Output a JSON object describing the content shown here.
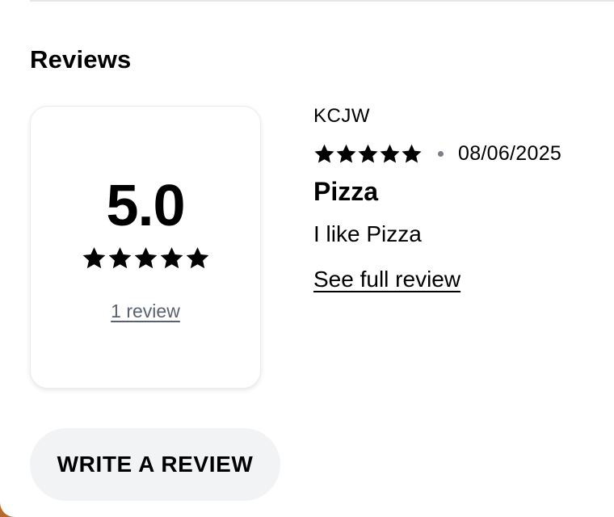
{
  "section": {
    "title": "Reviews"
  },
  "summary": {
    "average": "5.0",
    "stars": 5,
    "max_stars": 5,
    "count_label": "1 review"
  },
  "review": {
    "reviewer": "KCJW",
    "stars": 5,
    "max_stars": 5,
    "date": "08/06/2025",
    "title": "Pizza",
    "body": "I like Pizza",
    "link_label": "See full review"
  },
  "actions": {
    "write_label": "WRITE A REVIEW"
  },
  "icons": {
    "rating": "star-icon",
    "separator": "dot-separator"
  },
  "colors": {
    "star": "#000000",
    "muted_text": "#5a6270",
    "button_bg": "#f2f3f5"
  }
}
